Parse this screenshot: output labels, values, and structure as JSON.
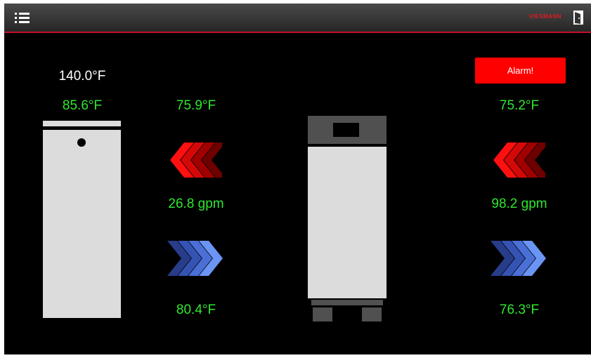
{
  "header": {
    "menu_icon": "list-menu-icon",
    "brand": "VIESMANN",
    "exit_icon": "door-exit-icon",
    "accent_color": "#c8102e"
  },
  "tank": {
    "setpoint": "140.0°F",
    "temperature": "85.6°F"
  },
  "loop1": {
    "supply_temp": "75.9°F",
    "flow": "26.8 gpm",
    "return_temp": "80.4°F",
    "supply_arrow_icon": "red-chevrons-left-icon",
    "return_arrow_icon": "blue-chevrons-right-icon"
  },
  "loop2": {
    "alarm_label": "Alarm!",
    "supply_temp": "75.2°F",
    "flow": "98.2 gpm",
    "return_temp": "76.3°F",
    "supply_arrow_icon": "red-chevrons-left-icon",
    "return_arrow_icon": "blue-chevrons-right-icon"
  },
  "colors": {
    "value_green": "#2ee82e",
    "alarm_red": "#ff0000",
    "equipment_gray": "#dcdcdc"
  }
}
